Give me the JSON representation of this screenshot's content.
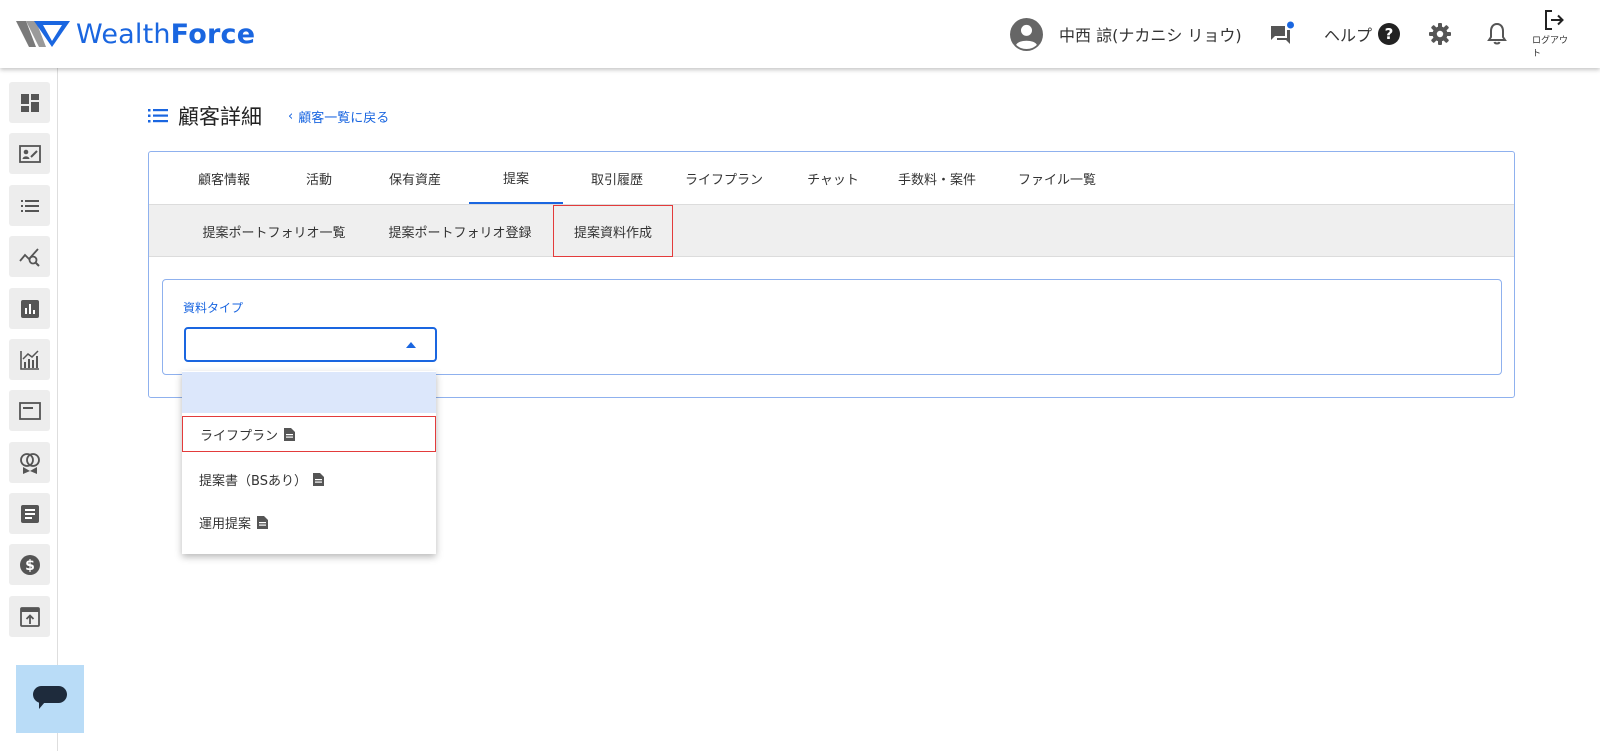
{
  "header": {
    "logo": {
      "part1": "Wealth",
      "part2": "Force"
    },
    "user_name": "中西 諒(ナカニシ リョウ)",
    "help_label": "ヘルプ",
    "logout_label": "ログアウト",
    "icons": [
      "user-avatar-icon",
      "chat-notification-icon",
      "help-circle-icon",
      "gear-icon",
      "bell-icon",
      "logout-icon"
    ],
    "notification_color": "#1a66e0"
  },
  "sidebar": {
    "items": [
      "dashboard-icon",
      "customer-card-icon",
      "list-icon",
      "trend-search-icon",
      "bar-chart-icon",
      "growth-chart-icon",
      "window-icon",
      "rings-icon",
      "document-icon",
      "dollar-icon",
      "upload-icon"
    ],
    "chat_button_icon": "chat-bubble-icon"
  },
  "page": {
    "title": "顧客詳細",
    "back_link": "顧客一覧に戻る"
  },
  "tabs": [
    {
      "label": "顧客情報",
      "active": false
    },
    {
      "label": "活動",
      "active": false
    },
    {
      "label": "保有資産",
      "active": false
    },
    {
      "label": "提案",
      "active": true
    },
    {
      "label": "取引履歴",
      "active": false
    },
    {
      "label": "ライフプラン",
      "active": false
    },
    {
      "label": "チャット",
      "active": false
    },
    {
      "label": "手数料・案件",
      "active": false
    },
    {
      "label": "ファイル一覧",
      "active": false
    }
  ],
  "subtabs": [
    {
      "label": "提案ポートフォリオ一覧",
      "highlighted": false
    },
    {
      "label": "提案ポートフォリオ登録",
      "highlighted": false
    },
    {
      "label": "提案資料作成",
      "highlighted": true
    }
  ],
  "form": {
    "field_label": "資料タイプ",
    "selected_value": ""
  },
  "dropdown": {
    "options": [
      {
        "label": "",
        "state": "hovered"
      },
      {
        "label": "ライフプラン",
        "state": "highlighted"
      },
      {
        "label": "提案書（BSあり）",
        "state": "normal"
      },
      {
        "label": "運用提案",
        "state": "normal"
      }
    ]
  },
  "colors": {
    "accent": "#1a66e0",
    "highlight_border": "#e33b3b",
    "card_border": "#8fb1ee",
    "subtab_bg": "#efefef",
    "hover_option_bg": "#dce7fb",
    "chat_fab_bg": "#b9dcf7"
  }
}
